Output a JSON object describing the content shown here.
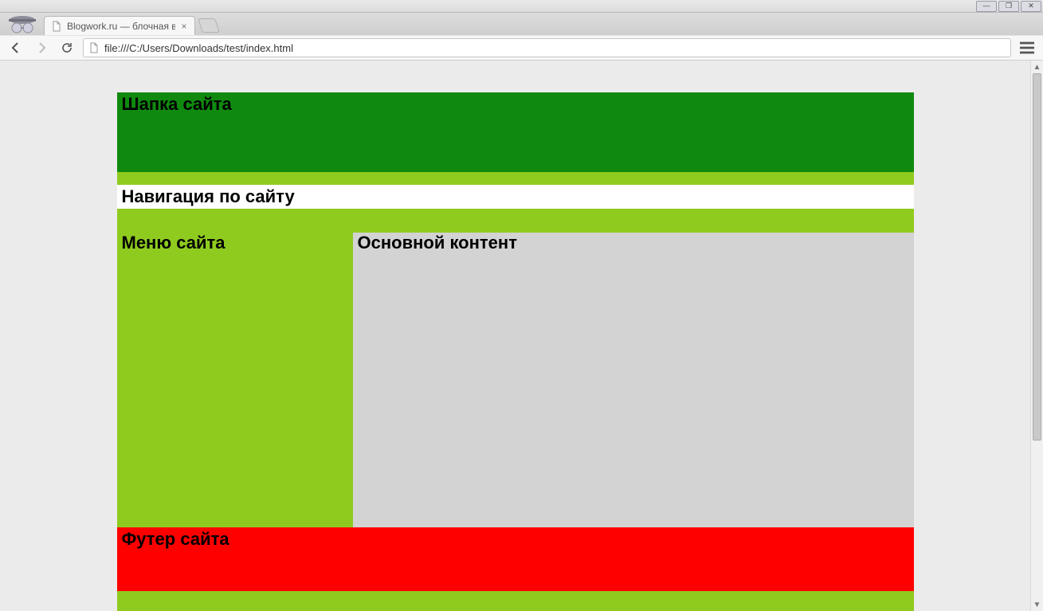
{
  "browser": {
    "tab_title": "Blogwork.ru — блочная вер",
    "url": "file:///C:/Users/Downloads/test/index.html"
  },
  "page": {
    "header": "Шапка сайта",
    "nav": "Навигация по сайту",
    "menu": "Меню сайта",
    "content": "Основной контент",
    "footer": "Футер сайта"
  }
}
